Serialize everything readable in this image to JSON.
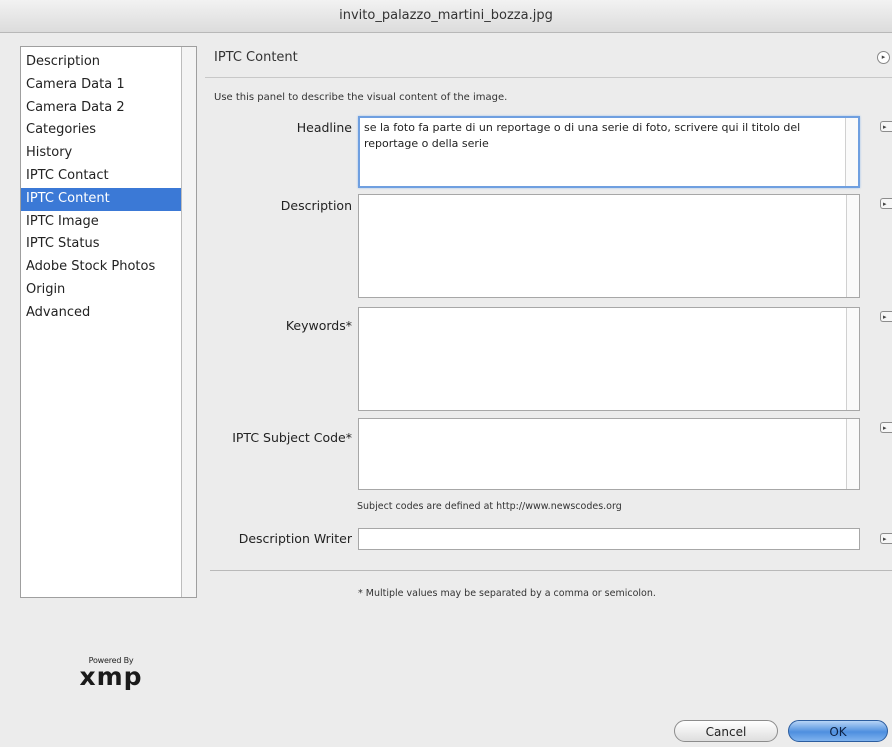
{
  "window": {
    "title": "invito_palazzo_martini_bozza.jpg"
  },
  "sidebar": {
    "items": [
      {
        "label": "Description"
      },
      {
        "label": "Camera Data 1"
      },
      {
        "label": "Camera Data 2"
      },
      {
        "label": "Categories"
      },
      {
        "label": "History"
      },
      {
        "label": "IPTC Contact"
      },
      {
        "label": "IPTC Content",
        "selected": true
      },
      {
        "label": "IPTC Image"
      },
      {
        "label": "IPTC Status"
      },
      {
        "label": "Adobe Stock Photos"
      },
      {
        "label": "Origin"
      },
      {
        "label": "Advanced"
      }
    ]
  },
  "panel": {
    "title": "IPTC Content",
    "intro": "Use this panel to describe the visual content of the image.",
    "fields": {
      "headline": {
        "label": "Headline",
        "value": "se la foto fa parte di un reportage o di una serie di foto, scrivere qui il titolo del reportage o della serie"
      },
      "description": {
        "label": "Description",
        "value": ""
      },
      "keywords": {
        "label": "Keywords*",
        "value": ""
      },
      "subject_code": {
        "label": "IPTC Subject Code*",
        "value": ""
      },
      "description_writer": {
        "label": "Description Writer",
        "value": ""
      }
    },
    "subject_hint": "Subject codes are defined at http://www.newscodes.org",
    "footnote": "* Multiple values may be separated by a comma or semicolon."
  },
  "logo": {
    "powered_by": "Powered By",
    "name": "xmp"
  },
  "buttons": {
    "cancel": "Cancel",
    "ok": "OK"
  },
  "icons": {
    "panel_menu": "circle-arrow-icon",
    "field_menu": "dropdown-arrow-icon"
  },
  "colors": {
    "selection": "#3b79d6",
    "focus_ring": "#6f9fe0",
    "ok_button": "#4e8fdf"
  }
}
